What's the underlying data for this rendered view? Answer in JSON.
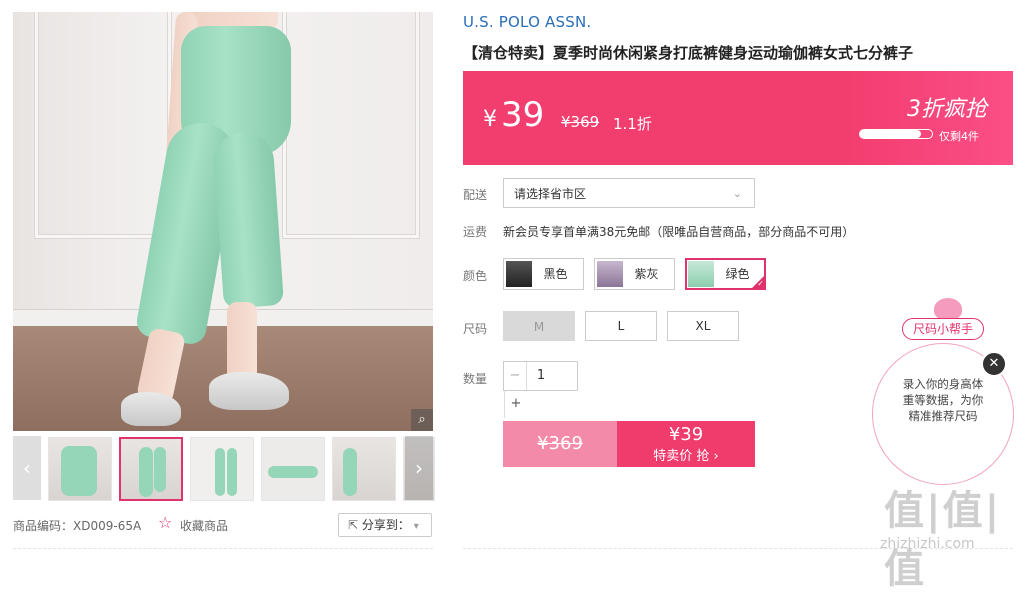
{
  "product": {
    "brand": "U.S. POLO ASSN.",
    "title": "【清仓特卖】夏季时尚休闲紧身打底裤健身运动瑜伽裤女式七分裤子",
    "code_label": "商品编码：XD009-65A",
    "favorite_label": "收藏商品",
    "share_label": "分享到："
  },
  "price": {
    "yen": "¥",
    "value": "39",
    "old_price": "¥369",
    "discount": "1.1折",
    "promo_tag": "3折疯抢",
    "stock_text": "仅剩4件",
    "stock_fraction": 0.85
  },
  "delivery": {
    "label": "配送",
    "placeholder": "请选择省市区"
  },
  "shipping": {
    "label": "运费",
    "text": "新会员专享首单满38元免邮（限唯品自营商品，部分商品不可用）"
  },
  "color": {
    "label": "颜色",
    "options": [
      {
        "name": "黑色",
        "state": "normal"
      },
      {
        "name": "紫灰",
        "state": "normal"
      },
      {
        "name": "绿色",
        "state": "selected"
      }
    ]
  },
  "size": {
    "label": "尺码",
    "options": [
      {
        "name": "M",
        "state": "disabled"
      },
      {
        "name": "L",
        "state": "normal"
      },
      {
        "name": "XL",
        "state": "normal"
      }
    ]
  },
  "quantity": {
    "label": "数量",
    "minus": "−",
    "value": "1",
    "plus": "+"
  },
  "buy": {
    "old_price": "¥369",
    "price": "¥39",
    "action": "特卖价 抢 ›"
  },
  "helper": {
    "tag": "尺码小帮手",
    "line1": "录入你的身高体",
    "line2": "重等数据，为你",
    "line3": "精准推荐尺码",
    "close": "✕"
  },
  "watermark": {
    "logo": "值|值|值",
    "url": "zhizhizhi.com"
  },
  "icons": {
    "zoom": "magnifier-icon",
    "star": "star-icon",
    "share": "share-icon",
    "prev": "chevron-left-icon",
    "next": "chevron-right-icon",
    "dropdown": "chevron-down-icon"
  },
  "colors": {
    "accent": "#ef3c6d",
    "brand_blue": "#2a6db8",
    "leggings_green": "#96d6b8"
  }
}
